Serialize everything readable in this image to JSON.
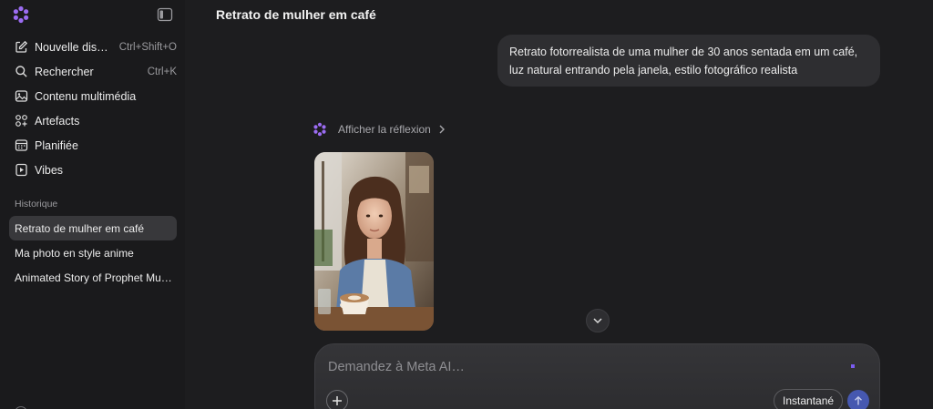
{
  "sidebar": {
    "nav": [
      {
        "label": "Nouvelle dis…",
        "shortcut": "Ctrl+Shift+O",
        "icon": "new-chat-icon"
      },
      {
        "label": "Rechercher",
        "shortcut": "Ctrl+K",
        "icon": "search-icon"
      },
      {
        "label": "Contenu multimédia",
        "icon": "image-icon"
      },
      {
        "label": "Artefacts",
        "icon": "artifacts-icon"
      },
      {
        "label": "Planifiée",
        "icon": "calendar-icon"
      },
      {
        "label": "Vibes",
        "icon": "play-icon"
      }
    ],
    "history_title": "Historique",
    "history": [
      {
        "label": "Retrato de mulher em café",
        "active": true
      },
      {
        "label": "Ma photo en style anime",
        "active": false
      },
      {
        "label": "Animated Story of Prophet Mu…",
        "active": false
      }
    ]
  },
  "main": {
    "title": "Retrato de mulher em café",
    "user_message": "Retrato fotorrealista de uma mulher de 30 anos sentada em um café, luz natural entrando pela janela, estilo fotográfico realista",
    "thinking_label": "Afficher la réflexion"
  },
  "composer": {
    "placeholder": "Demandez à Meta AI…",
    "mode_label": "Instantané"
  },
  "colors": {
    "background": "#1d1d1f",
    "sidebar": "#1a1a1c",
    "bubble": "#2e2e31",
    "accent": "#7b5cf0",
    "send": "#4658b0"
  }
}
